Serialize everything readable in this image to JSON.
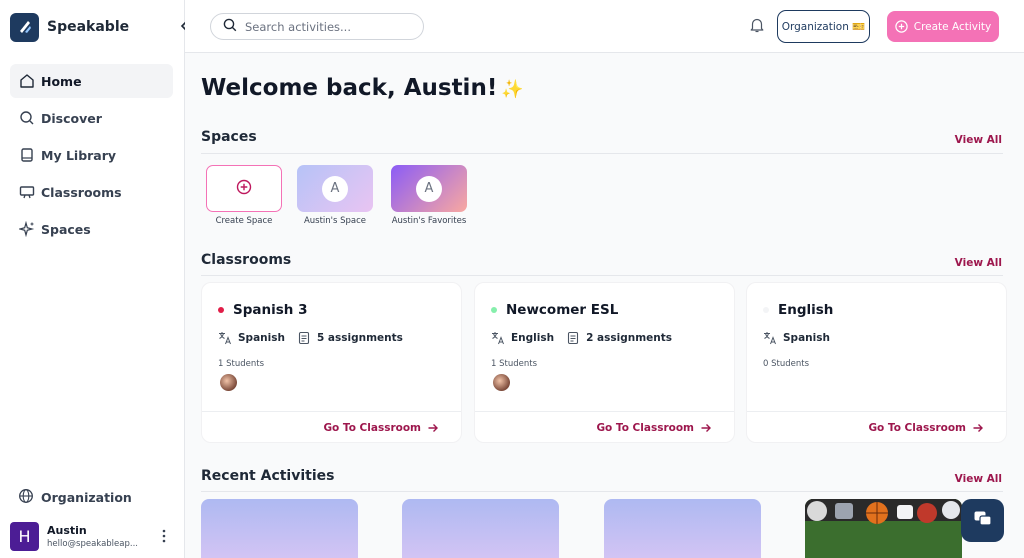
{
  "brand": {
    "name": "Speakable"
  },
  "sidebar": {
    "items": [
      {
        "label": "Home",
        "icon": "home-icon"
      },
      {
        "label": "Discover",
        "icon": "search-icon"
      },
      {
        "label": "My Library",
        "icon": "book-icon"
      },
      {
        "label": "Classrooms",
        "icon": "classroom-icon"
      },
      {
        "label": "Spaces",
        "icon": "sparkle-icon"
      }
    ],
    "organization": {
      "label": "Organization",
      "icon": "globe-icon"
    },
    "user": {
      "initial": "H",
      "name": "Austin",
      "email": "hello@speakableap..."
    }
  },
  "topbar": {
    "search_placeholder": "Search activities...",
    "org_button": "Organization 🎫",
    "create_button": "Create Activity"
  },
  "main": {
    "welcome": "Welcome back, Austin!",
    "spaces": {
      "title": "Spaces",
      "view_all": "View All",
      "items": [
        {
          "label": "Create Space",
          "type": "create"
        },
        {
          "label": "Austin's Space",
          "initial": "A"
        },
        {
          "label": "Austin's Favorites",
          "initial": "A"
        }
      ]
    },
    "classrooms": {
      "title": "Classrooms",
      "view_all": "View All",
      "cta": "Go To Classroom",
      "items": [
        {
          "name": "Spanish 3",
          "dot_color": "#e11d48",
          "language": "Spanish",
          "assignments": "5 assignments",
          "students": "1 Students"
        },
        {
          "name": "Newcomer ESL",
          "dot_color": "#86efac",
          "language": "English",
          "assignments": "2 assignments",
          "students": "1 Students"
        },
        {
          "name": "English",
          "dot_color": "#f3f4f6",
          "language": "Spanish",
          "assignments": "",
          "students": "0 Students"
        }
      ]
    },
    "recent": {
      "title": "Recent Activities",
      "view_all": "View All"
    }
  },
  "colors": {
    "accent": "#9d174d",
    "brand_dark": "#1e3a5f",
    "create_button": "#f472b6"
  }
}
